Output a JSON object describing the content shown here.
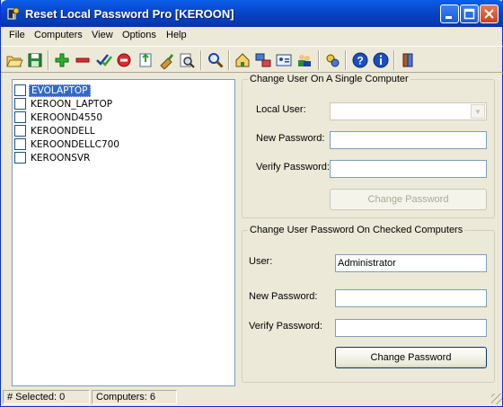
{
  "window": {
    "title": "Reset Local Password Pro [KEROON]"
  },
  "menu": [
    {
      "label": "File"
    },
    {
      "label": "Computers"
    },
    {
      "label": "View"
    },
    {
      "label": "Options"
    },
    {
      "label": "Help"
    }
  ],
  "toolbar": {
    "icons": [
      "open-folder-icon",
      "save-icon",
      "add-icon",
      "remove-icon",
      "check-all-icon",
      "stop-icon",
      "import-icon",
      "clear-icon",
      "preview-icon",
      "find-icon",
      "home-network-icon",
      "network-computers-icon",
      "user-card-icon",
      "users-icon",
      "settings-icon",
      "help-icon",
      "info-icon",
      "exit-icon"
    ]
  },
  "computers": [
    {
      "name": "EVOLAPTOP",
      "checked": false,
      "selected": true
    },
    {
      "name": "KEROON_LAPTOP",
      "checked": false,
      "selected": false
    },
    {
      "name": "KEROOND4550",
      "checked": false,
      "selected": false
    },
    {
      "name": "KEROONDELL",
      "checked": false,
      "selected": false
    },
    {
      "name": "KEROONDELLC700",
      "checked": false,
      "selected": false
    },
    {
      "name": "KEROONSVR",
      "checked": false,
      "selected": false
    }
  ],
  "single": {
    "legend": "Change User On A Single Computer",
    "local_user_label": "Local User:",
    "local_user_value": "",
    "new_password_label": "New Password:",
    "verify_password_label": "Verify Password:",
    "button": "Change Password"
  },
  "checked": {
    "legend": "Change User Password On Checked Computers",
    "user_label": "User:",
    "user_value": "Administrator",
    "new_password_label": "New Password:",
    "verify_password_label": "Verify Password:",
    "button": "Change Password"
  },
  "status": {
    "selected": "# Selected: 0",
    "computers": "Computers: 6"
  },
  "colors": {
    "title_bar": "#0845c9",
    "selection": "#316ac5",
    "face": "#ece9d8"
  }
}
